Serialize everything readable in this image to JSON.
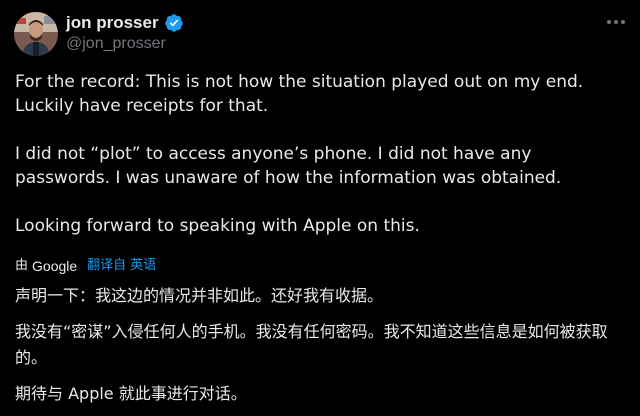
{
  "author": {
    "display_name": "jon prosser",
    "handle": "@jon_prosser",
    "verified_icon": "verified-badge-icon",
    "avatar_icon": "avatar-photo"
  },
  "colors": {
    "background": "#000000",
    "text": "#e7e9ea",
    "secondary": "#71767b",
    "accent": "#1d9bf0"
  },
  "tweet": {
    "paragraphs": [
      "For the record: This is not how the situation played out on my end. Luckily have receipts for that.",
      "I did not “plot” to access anyone’s phone. I did not have any passwords. I was unaware of how the information was obtained.",
      "Looking forward to speaking with Apple on this."
    ]
  },
  "translation": {
    "by_prefix": "由",
    "provider": "Google",
    "link_label": "翻译自 英语",
    "paragraphs": [
      "声明一下：我这边的情况并非如此。还好我有收据。",
      "我没有“密谋”入侵任何人的手机。我没有任何密码。我不知道这些信息是如何被获取的。",
      "期待与 Apple 就此事进行对话。"
    ]
  },
  "menu": {
    "more_icon": "more-options-icon"
  }
}
